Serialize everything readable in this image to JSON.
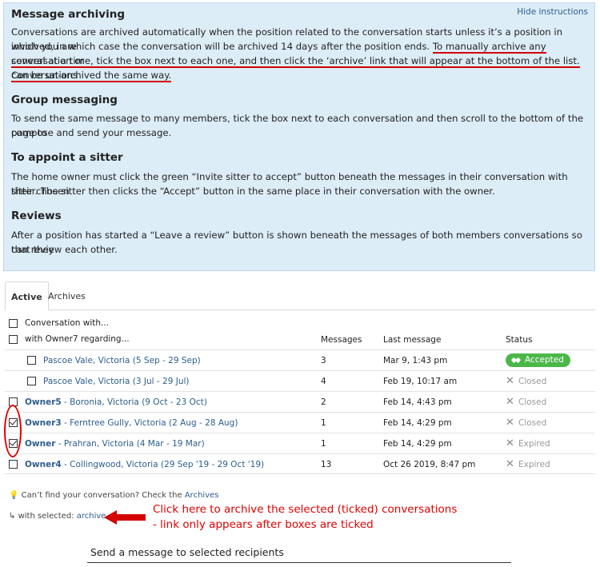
{
  "info": {
    "archiving_title": "Message archiving",
    "hide_label": "Hide instructions",
    "archiving_line1": "Conversations are archived automatically when the position related to the conversation starts unless it’s a position in which you are",
    "archiving_line2a": "involved, in which case the conversation will be archived 14 days after the position ends. ",
    "archiving_line2b": "To manually archive any conversation or",
    "archiving_line3": "several at a time, tick the box next to each one, and then click the ‘archive’ link that will appear at the bottom of the list. Conversations",
    "archiving_line4": "can be un-archived the same way.",
    "group_title": "Group messaging",
    "group_line1": "To send the same message to many members, tick the box next to each conversation and then scroll to the bottom of the page to",
    "group_line2": "compose and send your message.",
    "sitter_title": "To appoint a sitter",
    "sitter_line1": "The home owner must click the green “Invite sitter to accept” button beneath the messages in their conversation with their chosen",
    "sitter_line2": "sitter. The sitter then clicks the “Accept” button in the same place in their conversation with the owner.",
    "reviews_title": "Reviews",
    "reviews_line1": "After a position has started a “Leave a review” button is shown beneath the messages of both members conversations so that they",
    "reviews_line2": "can review each other."
  },
  "tabs": {
    "active": "Active",
    "archives": "Archives"
  },
  "table": {
    "group_header": "Conversation with...",
    "subgroup_header": "with Owner7 regarding...",
    "col_messages": "Messages",
    "col_last": "Last message",
    "col_status": "Status",
    "rows": [
      {
        "name": "",
        "loc": "Pascoe Vale, Victoria (5 Sep - 29 Sep)",
        "messages": "3",
        "last": "Mar 9, 1:43 pm",
        "status": "Accepted",
        "checked": false
      },
      {
        "name": "",
        "loc": "Pascoe Vale, Victoria (3 Jul - 29 Jul)",
        "messages": "4",
        "last": "Feb 19, 10:17 am",
        "status": "Closed",
        "checked": false
      },
      {
        "name": "Owner5",
        "loc": " - Boronia, Victoria (9 Oct - 23 Oct)",
        "messages": "2",
        "last": "Feb 14, 4:43 pm",
        "status": "Closed",
        "checked": false
      },
      {
        "name": "Owner3",
        "loc": " - Ferntree Gully, Victoria (2 Aug - 28 Aug)",
        "messages": "1",
        "last": "Feb 14, 4:29 pm",
        "status": "Closed",
        "checked": true
      },
      {
        "name": "Owner",
        "loc": " - Prahran, Victoria (4 Mar - 19 Mar)",
        "messages": "1",
        "last": "Feb 14, 4:29 pm",
        "status": "Expired",
        "checked": true
      },
      {
        "name": "Owner4",
        "loc": " - Collingwood, Victoria (29 Sep '19 - 29 Oct '19)",
        "messages": "13",
        "last": "Oct 26 2019, 8:47 pm",
        "status": "Expired",
        "checked": false
      }
    ]
  },
  "footer": {
    "cant_find": "Can’t find your conversation? Check the ",
    "archives_link": "Archives",
    "with_selected": "with selected: ",
    "archive_link": "archive"
  },
  "annotation": {
    "line1": "Click here to archive the selected (ticked) conversations",
    "line2": "- link only appears after boxes are ticked"
  },
  "compose": {
    "label": "Send a message to selected recipients"
  },
  "colors": {
    "accent": "#2c5d8e",
    "accepted": "#4cb749",
    "annotation": "#e00000",
    "info_bg": "#dcedf8"
  }
}
